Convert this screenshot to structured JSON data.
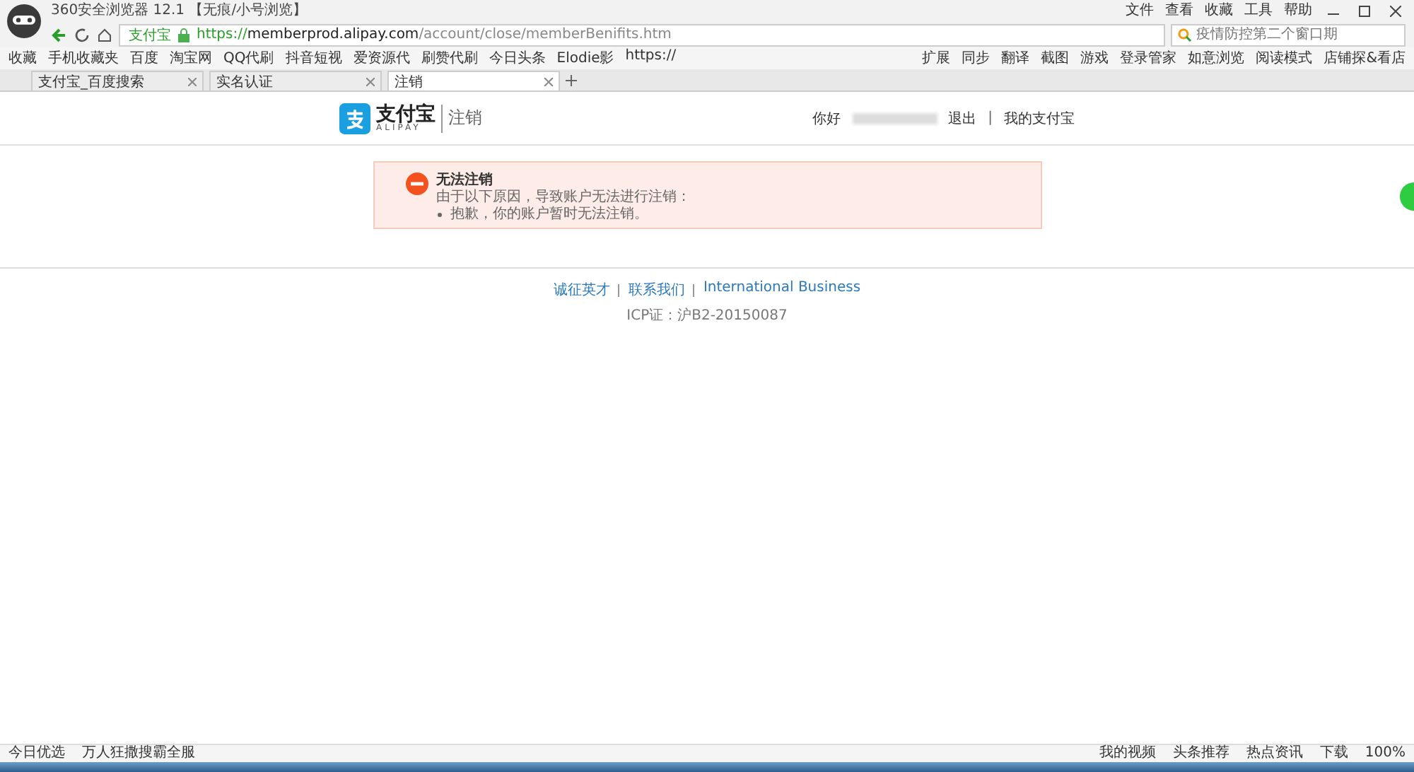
{
  "window": {
    "title": "360安全浏览器 12.1 【无痕/小号浏览】",
    "menu": [
      "文件",
      "查看",
      "收藏",
      "工具",
      "帮助"
    ]
  },
  "address_bar": {
    "site_label": "支付宝",
    "scheme": "https://",
    "host": "memberprod.alipay.com",
    "path": "/account/close/memberBenifits.htm"
  },
  "search": {
    "placeholder": "疫情防控第二个窗口期"
  },
  "bookmarks": [
    "收藏",
    "手机收藏夹",
    "百度",
    "淘宝网",
    "QQ代刷",
    "抖音短视",
    "爱资源代",
    "刷赞代刷",
    "今日头条",
    "Elodie影",
    "https://"
  ],
  "toolbar": [
    "扩展",
    "同步",
    "翻译",
    "截图",
    "游戏",
    "登录管家",
    "如意浏览",
    "阅读模式",
    "店铺探&看店"
  ],
  "tabs": [
    {
      "label": "支付宝_百度搜索",
      "selected": false
    },
    {
      "label": "实名认证",
      "selected": false
    },
    {
      "label": "注销",
      "selected": true
    }
  ],
  "page": {
    "logo_text": "支付宝",
    "logo_sub": "ALIPAY",
    "heading": "注销",
    "greeting": "你好",
    "logout": "退出",
    "separator": "|",
    "my_account": "我的支付宝"
  },
  "alert": {
    "title": "无法注销",
    "message": "由于以下原因，导致账户无法进行注销：",
    "reasons": [
      "抱歉，你的账户暂时无法注销。"
    ]
  },
  "footer": {
    "links": [
      "诚征英才",
      "联系我们",
      "International Business"
    ],
    "icp": "ICP证：沪B2-20150087"
  },
  "status_bar": {
    "left": [
      "今日优选",
      "万人狂撒搜霸全服"
    ],
    "right": [
      "我的视频",
      "头条推荐",
      "热点资讯",
      "下载"
    ],
    "zoom": "100%"
  }
}
